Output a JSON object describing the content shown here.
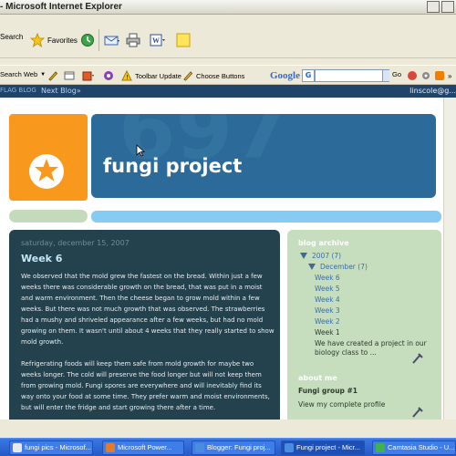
{
  "window": {
    "title": "- Microsoft Internet Explorer"
  },
  "toolbar": {
    "search_label": "Search",
    "favorites_label": "Favorites"
  },
  "links_toolbar": {
    "search_web_label": "Search Web",
    "toolbar_update_label": "Toolbar Update",
    "choose_buttons_label": "Choose Buttons",
    "google_logo": "Google",
    "google_combo": "G",
    "go_label": "Go"
  },
  "navbar": {
    "flag_label": "FLAG BLOG",
    "next_blog_label": "Next Blog»",
    "user_email": "linscole@g..."
  },
  "blog": {
    "title": "fungi project",
    "header_watermark": "697"
  },
  "post": {
    "date": "saturday, december 15, 2007",
    "title": "Week 6",
    "paragraphs": [
      "We observed that the mold grew the fastest on the bread. Within just a few weeks there was considerable growth on the bread, that was put in a moist and warm environment. Then the cheese began to grow mold within a few weeks. But there was not much growth that was observed. The strawberries had a mushy and shriveled appearance after a few weeks, but had no mold growing on them. It wasn't until about 4 weeks that they really started to show mold growth.",
      "Refrigerating foods will keep them safe from mold growth for maybe two weeks longer. The cold will preserve the food longer but will not keep them from growing mold. Fungi spores are everywhere and will inevitably find its way onto your food at some time. They prefer warm and moist environments, but will enter the fridge and start growing there after a time."
    ]
  },
  "sidebar": {
    "archive_heading": "blog archive",
    "year": "2007 (7)",
    "month": "December (7)",
    "weeks": [
      "Week 6",
      "Week 5",
      "Week 4",
      "Week 3",
      "Week 2",
      "Week 1"
    ],
    "week1_excerpt": "We have created a project in our biology class to ...",
    "about_heading": "about me",
    "profile_name": "Fungi group #1",
    "profile_link": "View my complete profile"
  },
  "taskbar": {
    "items": [
      "fungi pics - Microsof...",
      "Microsoft Power...",
      "Blogger: Fungi proj...",
      "Fungi project - Micr...",
      "Camtasia Studio - U..."
    ]
  },
  "colors": {
    "accent_orange": "#f8991d",
    "header_blue": "#2b6a99",
    "post_bg": "#24414e",
    "sidebar_bg": "#c6ddbe",
    "link_blue": "#3a6fa8"
  }
}
